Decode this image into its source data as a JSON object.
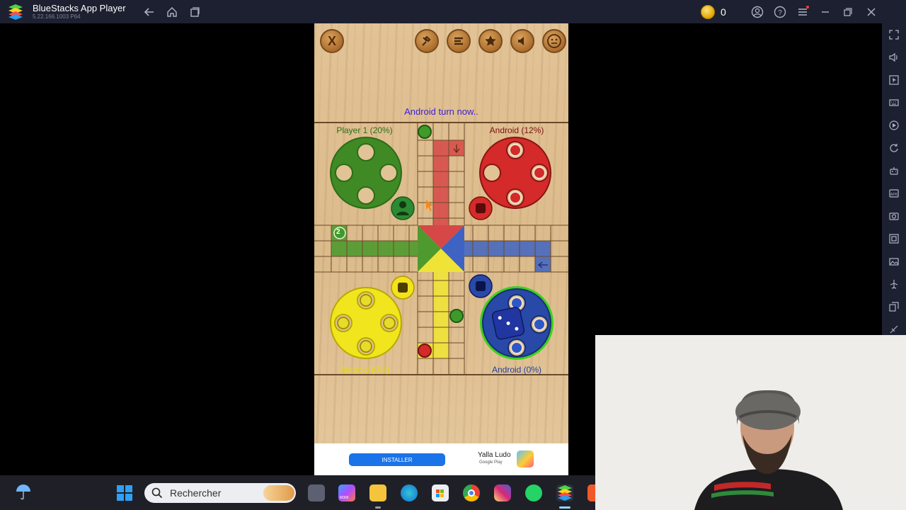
{
  "window": {
    "title": "BlueStacks App Player",
    "version": "5.22.166.1003  P64",
    "coins": "0"
  },
  "game": {
    "turn_text": "Android turn now..",
    "top_buttons": {
      "close_label": "X"
    },
    "players": {
      "top_left": "Player 1 (20%)",
      "top_right": "Android (12%)",
      "bottom_left": "Android (0%)",
      "bottom_right": "Android (0%)"
    },
    "green_counter": "2",
    "colors": {
      "green": "#3f8a25",
      "red": "#d42a2a",
      "yellow": "#f1e51d",
      "blue": "#2949a8"
    }
  },
  "ad": {
    "install_label": "INSTALLER",
    "app_name": "Yalla Ludo",
    "store": "Google Play"
  },
  "taskbar": {
    "search_placeholder": "Rechercher",
    "m365_label": "M365"
  }
}
